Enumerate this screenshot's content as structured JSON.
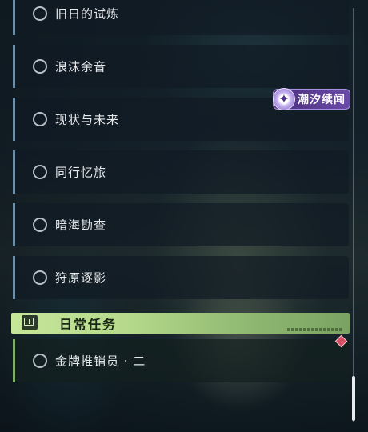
{
  "quests": [
    {
      "label": "旧日的试炼"
    },
    {
      "label": "浪沫余音"
    },
    {
      "label": "现状与未来"
    },
    {
      "label": "同行忆旅"
    },
    {
      "label": "暗海勘查"
    },
    {
      "label": "狩原逐影"
    }
  ],
  "tag_badge": {
    "label": "潮汐续闻",
    "icon": "sparkle-icon"
  },
  "daily_section": {
    "title": "日常任务",
    "icon": "notice-icon",
    "items": [
      {
        "label": "金牌推销员 · 二",
        "badge": "diamond-icon"
      }
    ]
  },
  "colors": {
    "quest_accent": "#6e8ea6",
    "daily_accent": "#7fae69",
    "daily_header": "#c6e69a",
    "tag_purple": "#6a4aa8",
    "alert_red": "#d65063"
  }
}
